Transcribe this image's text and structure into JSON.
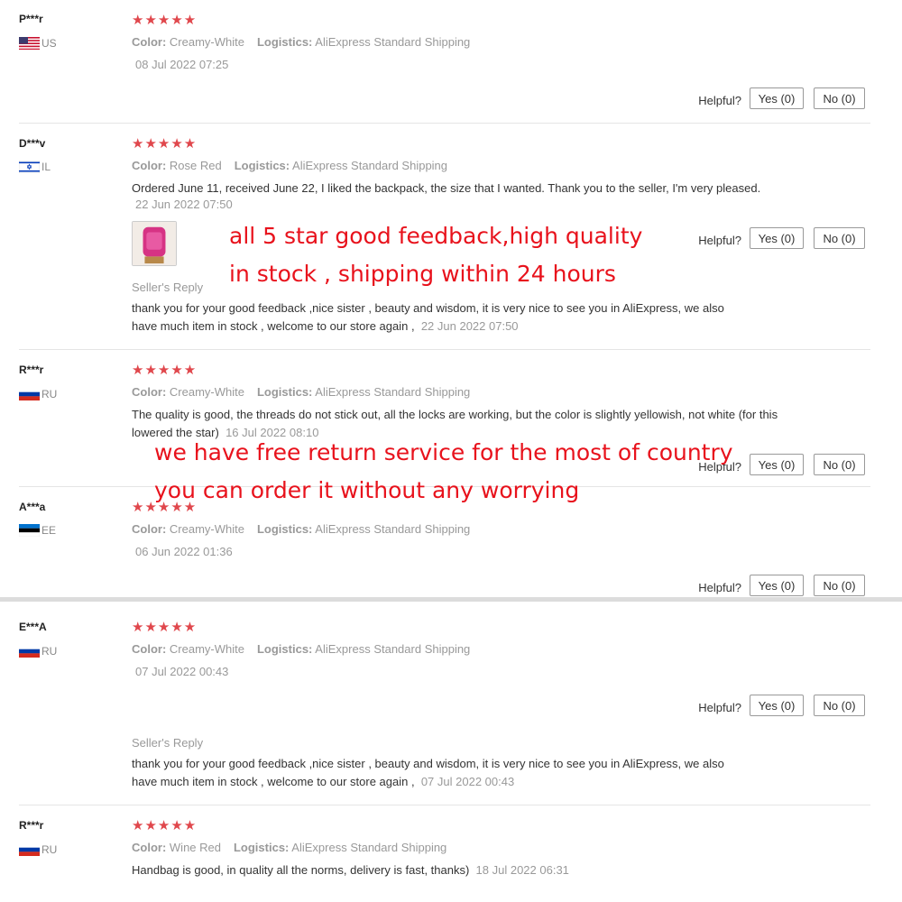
{
  "colors": {
    "star": "#e0474c",
    "overlay": "#e8121c",
    "muted": "#999999"
  },
  "reviews": [
    {
      "user": "P***r",
      "country": "US",
      "flag": "us-flag-icon",
      "stars": "★★★★★",
      "color_label": "Color:",
      "color": "Creamy-White",
      "logistics_label": "Logistics:",
      "logistics": "AliExpress Standard Shipping",
      "date": "08 Jul 2022 07:25",
      "helpful": "Helpful?",
      "yes": "Yes (0)",
      "no": "No (0)"
    },
    {
      "user": "D***v",
      "country": "IL",
      "flag": "il-flag-icon",
      "stars": "★★★★★",
      "color_label": "Color:",
      "color": "Rose Red",
      "logistics_label": "Logistics:",
      "logistics": "AliExpress Standard Shipping",
      "text": "Ordered June 11, received June 22, I liked the backpack, the size that I wanted. Thank you to the seller, I'm very pleased.",
      "date": "22 Jun 2022 07:50",
      "helpful": "Helpful?",
      "yes": "Yes (0)",
      "no": "No (0)",
      "seller_label": "Seller's Reply",
      "reply": "thank you for your good feedback ,nice sister , beauty and wisdom, it is very nice to see you in AliExpress, we also have much item in stock , welcome to our store again ,",
      "reply_date": "22 Jun 2022 07:50"
    },
    {
      "user": "R***r",
      "country": "RU",
      "flag": "ru-flag-icon",
      "stars": "★★★★★",
      "color_label": "Color:",
      "color": "Creamy-White",
      "logistics_label": "Logistics:",
      "logistics": "AliExpress Standard Shipping",
      "text": "The quality is good, the threads do not stick out, all the locks are working, but the color is slightly yellowish, not white (for this lowered the star)",
      "date": "16 Jul 2022 08:10",
      "helpful": "Helpful?",
      "yes": "Yes (0)",
      "no": "No (0)"
    },
    {
      "user": "A***a",
      "country": "EE",
      "flag": "ee-flag-icon",
      "stars": "★★★★★",
      "color_label": "Color:",
      "color": "Creamy-White",
      "logistics_label": "Logistics:",
      "logistics": "AliExpress Standard Shipping",
      "date": "06 Jun 2022 01:36",
      "helpful": "Helpful?",
      "yes": "Yes (0)",
      "no": "No (0)"
    },
    {
      "user": "E***A",
      "country": "RU",
      "flag": "ru-flag-icon",
      "stars": "★★★★★",
      "color_label": "Color:",
      "color": "Creamy-White",
      "logistics_label": "Logistics:",
      "logistics": "AliExpress Standard Shipping",
      "date": "07 Jul 2022 00:43",
      "helpful": "Helpful?",
      "yes": "Yes (0)",
      "no": "No (0)",
      "seller_label": "Seller's Reply",
      "reply": "thank you for your good feedback ,nice sister , beauty and wisdom, it is very nice to see you in AliExpress, we also have much item in stock , welcome to our store again ,",
      "reply_date": "07 Jul 2022 00:43"
    },
    {
      "user": "R***r",
      "country": "RU",
      "flag": "ru-flag-icon",
      "stars": "★★★★★",
      "color_label": "Color:",
      "color": "Wine Red",
      "logistics_label": "Logistics:",
      "logistics": "AliExpress Standard Shipping",
      "text": "Handbag is good, in quality all the norms, delivery is fast, thanks)",
      "date": "18 Jul 2022 06:31"
    }
  ],
  "overlays": {
    "line1": "all 5 star good feedback,high quality",
    "line2": "in stock , shipping within 24 hours",
    "line3": "we have free return service for the most of country",
    "line4": "you can order it without any worrying"
  }
}
